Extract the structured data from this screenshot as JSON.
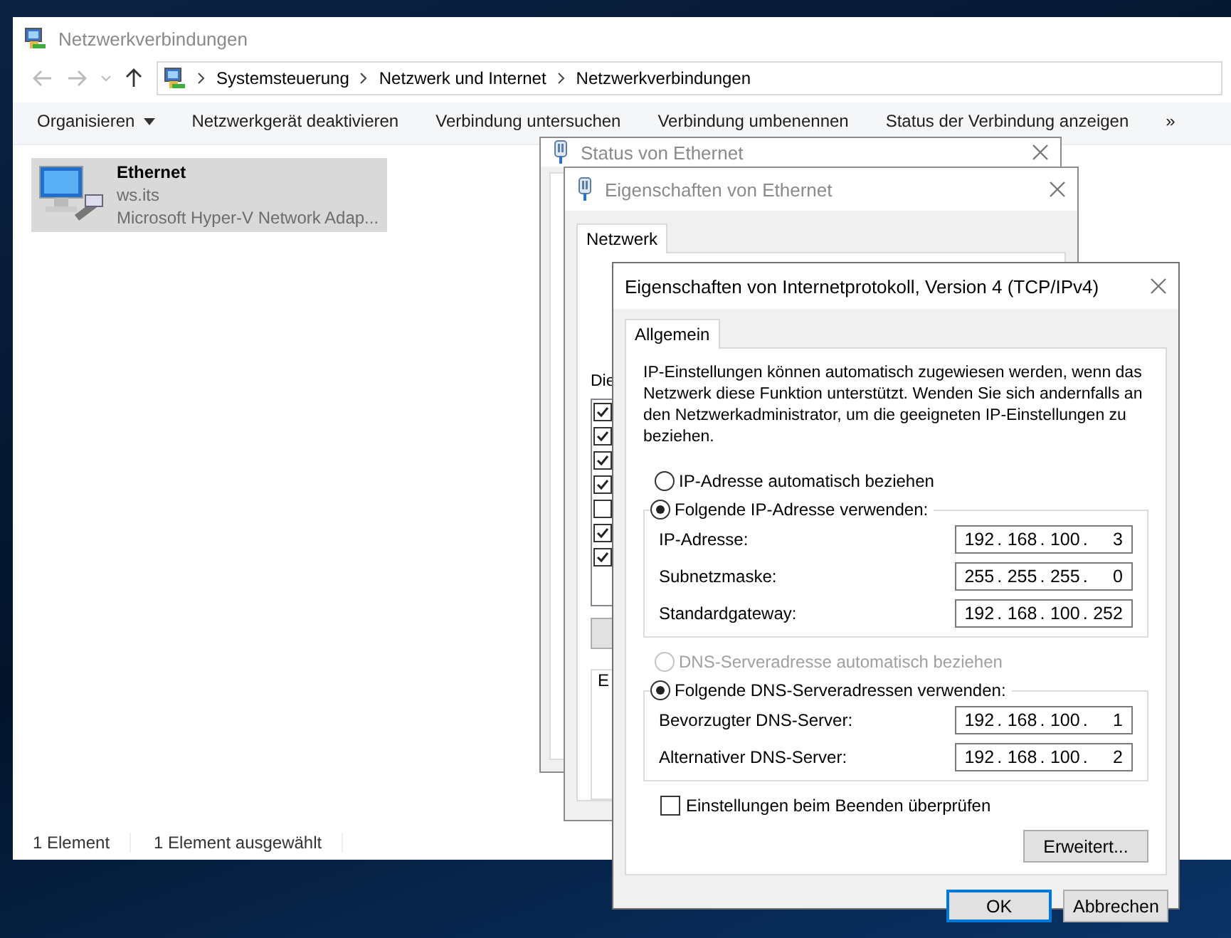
{
  "explorer": {
    "title": "Netzwerkverbindungen",
    "breadcrumbs": [
      "Systemsteuerung",
      "Netzwerk und Internet",
      "Netzwerkverbindungen"
    ],
    "toolbar": [
      {
        "kind": "menu",
        "label": "Organisieren"
      },
      {
        "kind": "command",
        "label": "Netzwerkgerät deaktivieren"
      },
      {
        "kind": "command",
        "label": "Verbindung untersuchen"
      },
      {
        "kind": "command",
        "label": "Verbindung umbenennen"
      },
      {
        "kind": "command",
        "label": "Status der Verbindung anzeigen"
      },
      {
        "kind": "overflow",
        "label": "»"
      }
    ],
    "items": [
      {
        "name": "Ethernet",
        "subtitle": "ws.its",
        "device": "Microsoft Hyper-V Network Adap...",
        "selected": true
      }
    ],
    "status_bar": [
      "1 Element",
      "1 Element ausgewählt"
    ]
  },
  "status_window": {
    "title": "Status von Ethernet"
  },
  "properties_window": {
    "title": "Eigenschaften von Ethernet",
    "tabs": [
      {
        "label": "Netzwerk",
        "selected": true
      }
    ],
    "list_label": "Die",
    "group_label": "E",
    "components": [
      {
        "checked": true
      },
      {
        "checked": true
      },
      {
        "checked": true
      },
      {
        "checked": true
      },
      {
        "checked": false
      },
      {
        "checked": true
      },
      {
        "checked": true
      }
    ]
  },
  "ipv4_dialog": {
    "title": "Eigenschaften von Internetprotokoll, Version 4 (TCP/IPv4)",
    "tabs": [
      {
        "label": "Allgemein",
        "selected": true
      }
    ],
    "description": "IP-Einstellungen können automatisch zugewiesen werden, wenn das Netzwerk diese Funktion unterstützt. Wenden Sie sich andernfalls an den Netzwerkadministrator, um die geeigneten IP-Einstellungen zu beziehen.",
    "separator": ".",
    "ip_options": [
      {
        "label": "IP-Adresse automatisch beziehen",
        "selected": false,
        "disabled": false
      },
      {
        "label": "Folgende IP-Adresse verwenden:",
        "selected": true,
        "disabled": false
      }
    ],
    "ip_fields": [
      {
        "label": "IP-Adresse:",
        "octets": [
          "192",
          "168",
          "100",
          "3"
        ]
      },
      {
        "label": "Subnetzmaske:",
        "octets": [
          "255",
          "255",
          "255",
          "0"
        ]
      },
      {
        "label": "Standardgateway:",
        "octets": [
          "192",
          "168",
          "100",
          "252"
        ]
      }
    ],
    "dns_options": [
      {
        "label": "DNS-Serveradresse automatisch beziehen",
        "selected": false,
        "disabled": true
      },
      {
        "label": "Folgende DNS-Serveradressen verwenden:",
        "selected": true,
        "disabled": false
      }
    ],
    "dns_fields": [
      {
        "label": "Bevorzugter DNS-Server:",
        "octets": [
          "192",
          "168",
          "100",
          "1"
        ]
      },
      {
        "label": "Alternativer DNS-Server:",
        "octets": [
          "192",
          "168",
          "100",
          "2"
        ]
      }
    ],
    "validate": {
      "label": "Einstellungen beim Beenden überprüfen",
      "checked": false
    },
    "advanced_button": "Erweitert...",
    "buttons": [
      {
        "label": "OK",
        "default": true
      },
      {
        "label": "Abbrechen",
        "default": false
      }
    ]
  }
}
